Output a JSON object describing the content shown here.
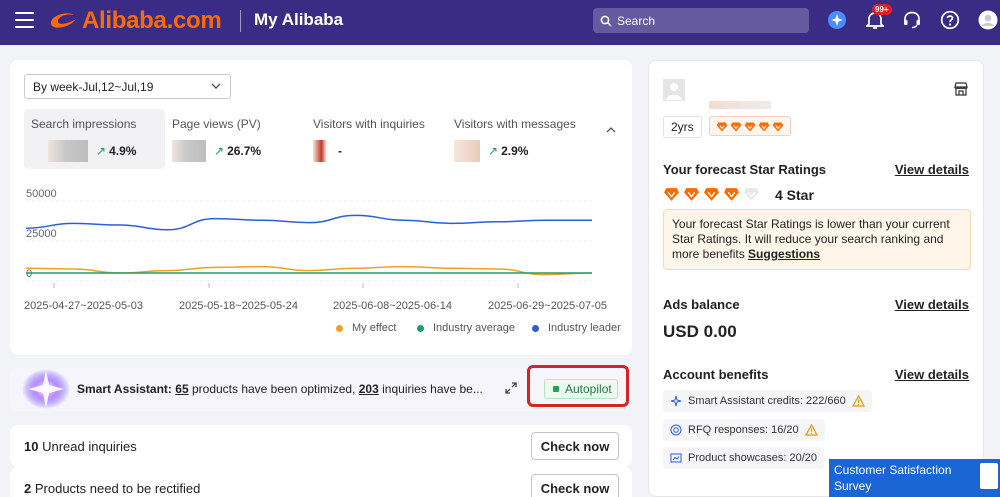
{
  "header": {
    "logo_text": "Alibaba.com",
    "title": "My Alibaba",
    "search_placeholder": "Search",
    "notification_badge": "99+",
    "brand_color": "#ff6a00",
    "bar_color": "#3a2c84"
  },
  "overview": {
    "week_select": "By week-Jul,12~Jul,19",
    "metrics": [
      {
        "label": "Search impressions",
        "change": "4.9%",
        "direction": "up"
      },
      {
        "label": "Page views (PV)",
        "change": "26.7%",
        "direction": "up"
      },
      {
        "label": "Visitors with inquiries",
        "change": "-",
        "direction": "none"
      },
      {
        "label": "Visitors with messages",
        "change": "2.9%",
        "direction": "up"
      }
    ]
  },
  "chart_data": {
    "type": "line",
    "yticks": [
      "50000",
      "25000",
      "0"
    ],
    "ylim": [
      0,
      50000
    ],
    "x_labels": [
      "2025-04-27~2025-05-03",
      "2025-05-18~2025-05-24",
      "2025-06-08~2025-06-14",
      "2025-06-29~2025-07-05"
    ],
    "x": [
      0,
      1,
      2,
      3,
      4,
      5,
      6,
      7,
      8,
      9,
      10,
      11,
      12
    ],
    "legend_position": "bottom-right",
    "grid": true,
    "series": [
      {
        "name": "My effect",
        "color": "#f0a020",
        "values": [
          3000,
          2500,
          0,
          1500,
          3500,
          4000,
          1500,
          3000,
          4000,
          3000,
          2500,
          -1000,
          0
        ]
      },
      {
        "name": "Industry average",
        "color": "#1aa06a",
        "values": [
          0,
          0,
          0,
          0,
          0,
          0,
          0,
          0,
          0,
          0,
          0,
          0,
          0
        ]
      },
      {
        "name": "Industry leader",
        "color": "#2a5fd8",
        "values": [
          28000,
          31000,
          30000,
          27000,
          34000,
          33000,
          31500,
          36000,
          33000,
          31000,
          32000,
          33000,
          33000
        ]
      }
    ]
  },
  "assistant": {
    "title": "Smart Assistant:",
    "products_count": "65",
    "text_mid": "products have been optimized,",
    "inquiries_count": "203",
    "text_end": "inquiries have be...",
    "autopilot_label": "Autopilot"
  },
  "tasks": [
    {
      "count": "10",
      "text": "Unread inquiries",
      "button": "Check now"
    },
    {
      "count": "2",
      "text": "Products need to be rectified",
      "button": "Check now"
    }
  ],
  "account": {
    "years": "2yrs",
    "star_heading": "Your forecast Star Ratings",
    "view_details": "View details",
    "star_rating": 4,
    "star_label": "4 Star",
    "forecast_note": "Your forecast Star Ratings is lower than your current Star Ratings. It will reduce your search ranking and more benefits",
    "suggestions_link": "Suggestions",
    "ads_heading": "Ads balance",
    "ads_balance": "USD 0.00",
    "benefits_heading": "Account benefits",
    "benefits": [
      {
        "text": "Smart Assistant credits: 222/660",
        "icon": "sparkle-icon",
        "warning": true
      },
      {
        "text": "RFQ responses: 16/20",
        "icon": "target-icon",
        "warning": true
      },
      {
        "text": "Product showcases: 20/20",
        "icon": "showcase-icon",
        "warning": false
      }
    ]
  },
  "survey": {
    "label": "Customer Satisfaction Survey"
  }
}
